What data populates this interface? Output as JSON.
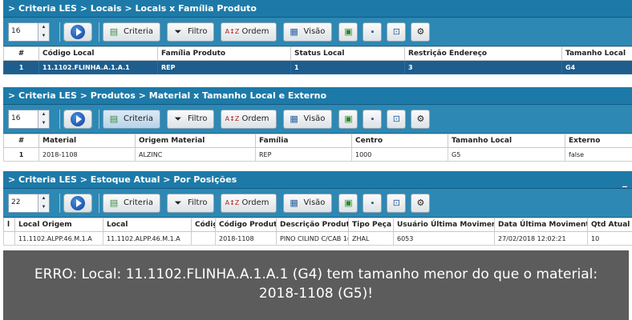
{
  "panel1": {
    "title": "> Criteria LES > Locais > Locais x Família Produto",
    "spinner_value": "16",
    "buttons": {
      "criteria": "Criteria",
      "filtro": "Filtro",
      "ordem": "Ordem",
      "visao": "Visão"
    },
    "columns": [
      "#",
      "Código Local",
      "Família Produto",
      "Status Local",
      "Restrição Endereço",
      "Tamanho Local"
    ],
    "rows": [
      [
        "1",
        "11.1102.FLINHA.A.1.A.1",
        "REP",
        "1",
        "3",
        "G4"
      ]
    ]
  },
  "panel2": {
    "title": "> Criteria LES > Produtos > Material x Tamanho Local e Externo",
    "spinner_value": "16",
    "buttons": {
      "criteria": "Criteria",
      "filtro": "Filtro",
      "ordem": "Ordem",
      "visao": "Visão"
    },
    "columns": [
      "#",
      "Material",
      "Origem Material",
      "Família",
      "Centro",
      "Tamanho Local",
      "Externo"
    ],
    "rows": [
      [
        "1",
        "2018-1108",
        "ALZINC",
        "REP",
        "1000",
        "G5",
        "false"
      ]
    ]
  },
  "panel3": {
    "title": "> Criteria LES > Estoque Atual > Por Posições",
    "minimize": "_",
    "spinner_value": "22",
    "buttons": {
      "criteria": "Criteria",
      "filtro": "Filtro",
      "ordem": "Ordem",
      "visao": "Visão"
    },
    "columns": [
      "l",
      "Local Origem",
      "Local",
      "Códig",
      "Código Produto",
      "Descrição Produto",
      "Tipo Peça",
      "Usuário Última Movimentaçã",
      "Data Última Movimentaçã",
      "Qtd Atual"
    ],
    "rows": [
      [
        "",
        "11.1102.ALPP.46.M.1.A",
        "11.1102.ALPP.46.M.1.A",
        "",
        "2018-1108",
        "PINO CILIND C/CAB 1(",
        "ZHAL",
        "6053",
        "27/02/2018 12:02:21",
        "10"
      ]
    ]
  },
  "error": {
    "line1": "ERRO: Local: 11.1102.FLINHA.A.1.A.1 (G4) tem tamanho menor do que o material:",
    "line2": "2018-1108 (G5)!"
  }
}
